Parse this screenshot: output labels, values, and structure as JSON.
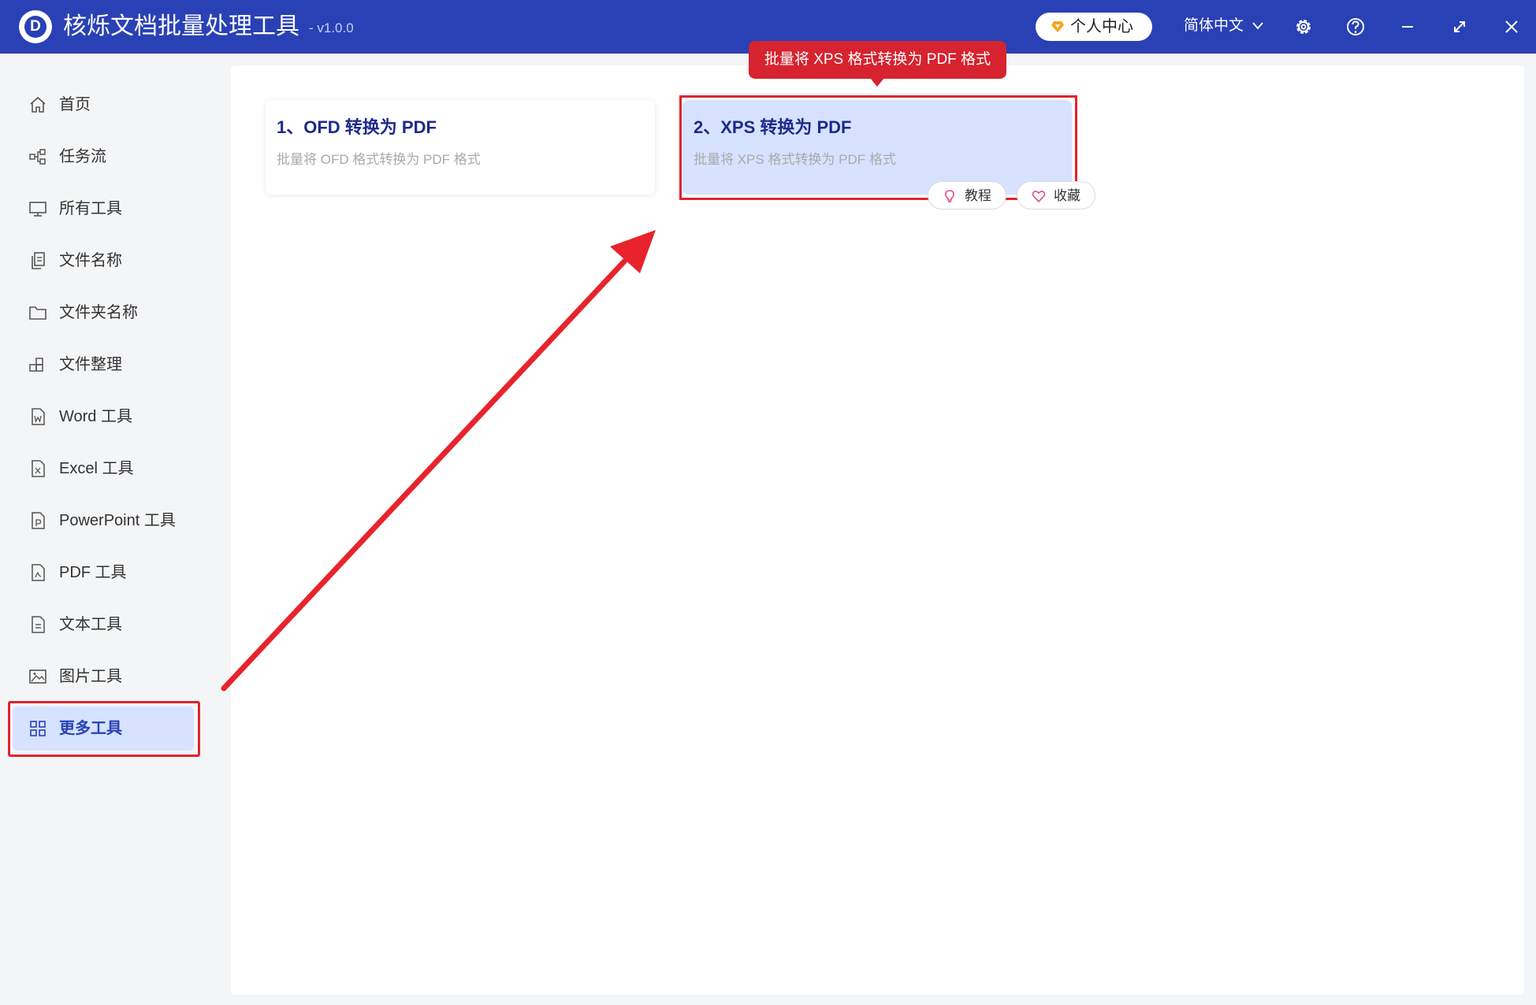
{
  "app": {
    "title": "核烁文档批量处理工具",
    "version": "- v1.0.0",
    "logo_letter": "D"
  },
  "header": {
    "user_center_label": "个人中心",
    "language_label": "简体中文"
  },
  "sidebar": {
    "items": [
      {
        "label": "首页",
        "icon": "home-icon"
      },
      {
        "label": "任务流",
        "icon": "workflow-icon"
      },
      {
        "label": "所有工具",
        "icon": "monitor-icon"
      },
      {
        "label": "文件名称",
        "icon": "file-copy-icon"
      },
      {
        "label": "文件夹名称",
        "icon": "folder-icon"
      },
      {
        "label": "文件整理",
        "icon": "organize-icon"
      },
      {
        "label": "Word 工具",
        "icon": "word-file-icon"
      },
      {
        "label": "Excel 工具",
        "icon": "excel-file-icon"
      },
      {
        "label": "PowerPoint 工具",
        "icon": "powerpoint-file-icon"
      },
      {
        "label": "PDF 工具",
        "icon": "pdf-file-icon"
      },
      {
        "label": "文本工具",
        "icon": "text-file-icon"
      },
      {
        "label": "图片工具",
        "icon": "image-icon"
      },
      {
        "label": "更多工具",
        "icon": "grid-icon",
        "active": true
      }
    ]
  },
  "tools": [
    {
      "title": "1、OFD 转换为 PDF",
      "desc": "批量将 OFD 格式转换为 PDF 格式"
    },
    {
      "title": "2、XPS 转换为 PDF",
      "desc": "批量将 XPS 格式转换为 PDF 格式",
      "active": true
    }
  ],
  "card_actions": {
    "tutorial_label": "教程",
    "favorite_label": "收藏"
  },
  "tooltip": {
    "text": "批量将 XPS 格式转换为 PDF 格式"
  },
  "colors": {
    "brand": "#2941b5",
    "active_bg": "#d6e2ff",
    "highlight_red": "#e0242c",
    "title_blue": "#1e2a8a"
  }
}
